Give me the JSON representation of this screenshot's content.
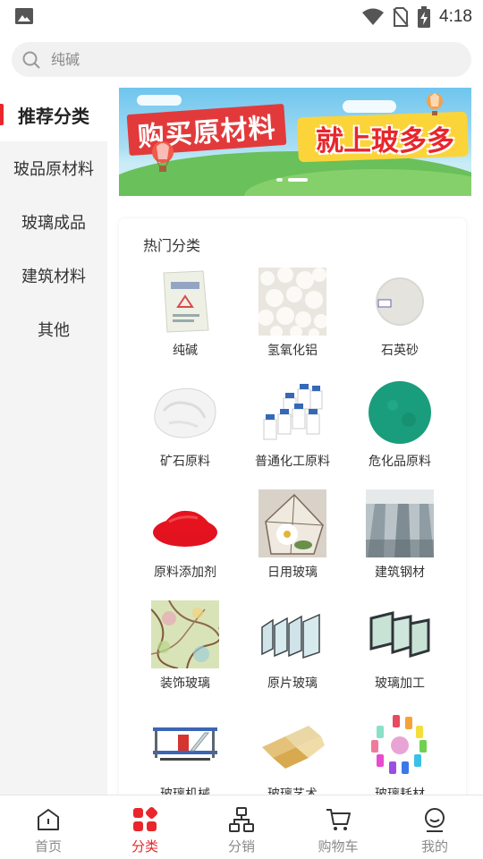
{
  "status_bar": {
    "time": "4:18",
    "icons": [
      "image-icon",
      "wifi-icon",
      "no-sim-icon",
      "battery-charging-icon"
    ]
  },
  "search": {
    "placeholder": "纯碱",
    "icon": "search-icon"
  },
  "sidebar": {
    "items": [
      {
        "label": "推荐分类",
        "active": true
      },
      {
        "label": "玻品原材料",
        "active": false
      },
      {
        "label": "玻璃成品",
        "active": false
      },
      {
        "label": "建筑材料",
        "active": false
      },
      {
        "label": "其他",
        "active": false
      }
    ]
  },
  "banner": {
    "text_left": "购买原材料",
    "text_right": "就上玻多多",
    "slides": 2,
    "active_slide": 2,
    "colors": {
      "red": "#e23a3b",
      "yellow": "#fbd43a",
      "sky": "#6fc5ee",
      "grass": "#6ac05a"
    }
  },
  "hot": {
    "title": "热门分类",
    "items": [
      {
        "label": "纯碱",
        "icon": "soda-ash-bag"
      },
      {
        "label": "氢氧化铝",
        "icon": "aluminum-hydroxide-powder"
      },
      {
        "label": "石英砂",
        "icon": "quartz-sand-dish"
      },
      {
        "label": "矿石原料",
        "icon": "ore-rock"
      },
      {
        "label": "普通化工原料",
        "icon": "chemical-bottles"
      },
      {
        "label": "危化品原料",
        "icon": "green-granules"
      },
      {
        "label": "原料添加剂",
        "icon": "red-pigment"
      },
      {
        "label": "日用玻璃",
        "icon": "glass-terrarium"
      },
      {
        "label": "建筑钢材",
        "icon": "steel-beams"
      },
      {
        "label": "装饰玻璃",
        "icon": "decorative-glass"
      },
      {
        "label": "原片玻璃",
        "icon": "glass-sheets"
      },
      {
        "label": "玻璃加工",
        "icon": "insulated-glass"
      },
      {
        "label": "玻璃机械",
        "icon": "glass-machine"
      },
      {
        "label": "玻璃艺术",
        "icon": "glass-tiles"
      },
      {
        "label": "玻璃耗材",
        "icon": "colored-glass-beads"
      }
    ]
  },
  "bottom_nav": {
    "items": [
      {
        "label": "首页",
        "icon": "home-icon",
        "active": false
      },
      {
        "label": "分类",
        "icon": "category-icon",
        "active": true
      },
      {
        "label": "分销",
        "icon": "distribution-icon",
        "active": false
      },
      {
        "label": "购物车",
        "icon": "cart-icon",
        "active": false
      },
      {
        "label": "我的",
        "icon": "profile-icon",
        "active": false
      }
    ],
    "active_color": "#e8262c"
  }
}
